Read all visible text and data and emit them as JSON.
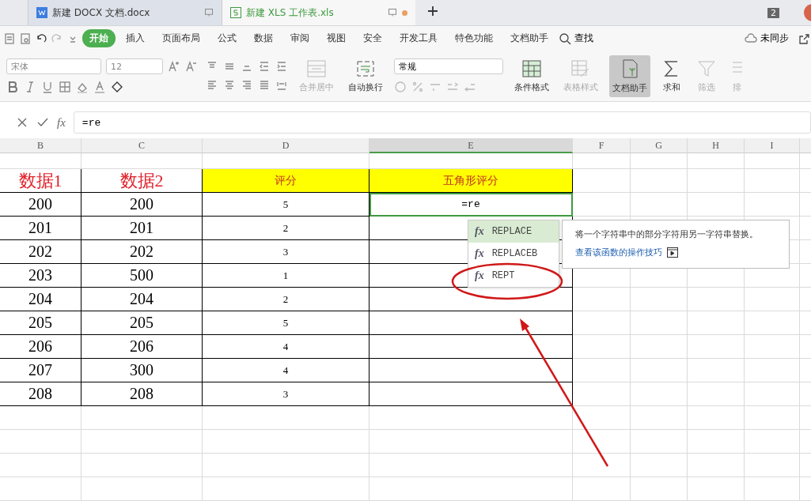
{
  "tabs": [
    {
      "label": "新建 DOCX 文档.docx",
      "kind": "writer",
      "selected": false,
      "unsaved": false
    },
    {
      "label": "新建 XLS 工作表.xls",
      "kind": "sheet",
      "selected": true,
      "unsaved": true
    }
  ],
  "window_count": "2",
  "menu": [
    {
      "label": "开始",
      "selected": true
    },
    {
      "label": "插入",
      "selected": false
    },
    {
      "label": "页面布局",
      "selected": false
    },
    {
      "label": "公式",
      "selected": false
    },
    {
      "label": "数据",
      "selected": false
    },
    {
      "label": "审阅",
      "selected": false
    },
    {
      "label": "视图",
      "selected": false
    },
    {
      "label": "安全",
      "selected": false
    },
    {
      "label": "开发工具",
      "selected": false
    },
    {
      "label": "特色功能",
      "selected": false
    },
    {
      "label": "文档助手",
      "selected": false
    }
  ],
  "find": "查找",
  "sync": "未同步",
  "ribbon": {
    "font": "宋体",
    "size": "12",
    "number_format": "常规",
    "buttons": [
      {
        "label": "合并居中",
        "disabled": true,
        "selected": false
      },
      {
        "label": "自动换行",
        "disabled": false,
        "selected": false
      },
      {
        "label": "条件格式",
        "disabled": false,
        "selected": false
      },
      {
        "label": "表格样式",
        "disabled": true,
        "selected": false
      },
      {
        "label": "文档助手",
        "disabled": false,
        "selected": true
      },
      {
        "label": "求和",
        "disabled": false,
        "selected": false
      },
      {
        "label": "筛选",
        "disabled": true,
        "selected": false
      },
      {
        "label": "排",
        "disabled": true,
        "selected": false
      }
    ]
  },
  "formula_bar": {
    "label": "fx",
    "value": "=re"
  },
  "columns": [
    {
      "label": "B",
      "selected": false
    },
    {
      "label": "C",
      "selected": false
    },
    {
      "label": "D",
      "selected": false
    },
    {
      "label": "E",
      "selected": true
    },
    {
      "label": "F",
      "selected": false
    },
    {
      "label": "G",
      "selected": false
    },
    {
      "label": "H",
      "selected": false
    },
    {
      "label": "I",
      "selected": false
    }
  ],
  "header_row": [
    "数据1",
    "数据2",
    "评分",
    "五角形评分"
  ],
  "rows": [
    {
      "cells": [
        "200",
        "200",
        "5",
        "=re"
      ],
      "editing": true
    },
    {
      "cells": [
        "201",
        "201",
        "2",
        ""
      ],
      "editing": false
    },
    {
      "cells": [
        "202",
        "202",
        "3",
        ""
      ],
      "editing": false
    },
    {
      "cells": [
        "203",
        "500",
        "1",
        ""
      ],
      "editing": false
    },
    {
      "cells": [
        "204",
        "204",
        "2",
        ""
      ],
      "editing": false
    },
    {
      "cells": [
        "205",
        "205",
        "5",
        ""
      ],
      "editing": false
    },
    {
      "cells": [
        "206",
        "206",
        "4",
        ""
      ],
      "editing": false
    },
    {
      "cells": [
        "207",
        "300",
        "4",
        ""
      ],
      "editing": false
    },
    {
      "cells": [
        "208",
        "208",
        "3",
        ""
      ],
      "editing": false
    }
  ],
  "autocomplete": [
    {
      "label": "fx",
      "name": "REPLACE",
      "selected": true
    },
    {
      "label": "fx",
      "name": "REPLACEB",
      "selected": false
    },
    {
      "label": "fx",
      "name": "REPT",
      "selected": false
    }
  ],
  "tooltip": {
    "description": "将一个字符串中的部分字符用另一字符串替换。",
    "link": "查看该函数的操作技巧"
  }
}
